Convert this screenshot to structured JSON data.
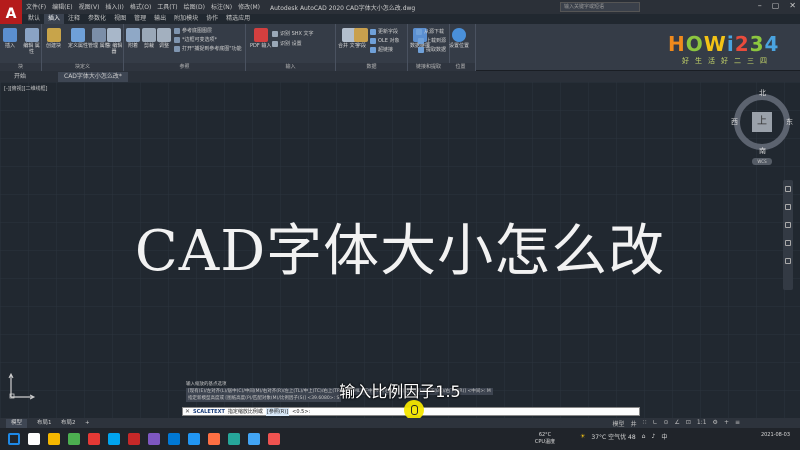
{
  "titlebar": {
    "app_letter": "A",
    "title": "Autodesk AutoCAD 2020   CAD字体大小怎么改.dwg",
    "search_placeholder": "输入关键字或短语",
    "menus": [
      "文件(F)",
      "编辑(E)",
      "视图(V)",
      "插入(I)",
      "格式(O)",
      "工具(T)",
      "绘图(D)",
      "标注(N)",
      "修改(M)"
    ]
  },
  "ribbon_tabs": [
    "默认",
    "插入",
    "注释",
    "参数化",
    "视图",
    "管理",
    "输出",
    "附加模块",
    "协作",
    "精选应用"
  ],
  "ribbon_active_tab": "插入",
  "ribbon": {
    "panels": {
      "block": "块",
      "block_def": "块定义",
      "reference": "参照",
      "import": "输入",
      "data": "数据",
      "link_extract": "链接和提取",
      "location": "位置"
    },
    "buttons": {
      "insert": "插入",
      "edit_attr": "编辑\n属性",
      "create_block": "创建块",
      "define_attr": "定义属性",
      "manage_attr": "管理\n属性",
      "block_editor": "块\n编辑器",
      "attach": "附着",
      "clip": "剪裁",
      "adjust": "调整",
      "pdf_import": "PDF\n输入",
      "merge_text": "合并\n文字",
      "field": "字段",
      "data_link": "数据链接",
      "set_location": "设置位置"
    },
    "small_items": {
      "ref_underlay": "参考底图图层",
      "frames": "*边框可变选项*",
      "snap": "打开\"捕捉到参考底图\"功能",
      "shx_text": "识别 SHX 文字",
      "settings": "识别 设置",
      "update_fields": "更新字段",
      "ole": "OLE 对象",
      "hyperlink": "超链接",
      "download_from_source": "从源下载",
      "upload_to_source": "上载到源",
      "extract_data": "提取数据"
    }
  },
  "brand": {
    "main": "HOWi234",
    "sub": "好生活好二三四",
    "colors": [
      "#f08a1c",
      "#8cc63f",
      "#f3c316",
      "#4aa3df",
      "#e94b3c",
      "#8cc63f",
      "#4aa3df"
    ]
  },
  "doc_tabs": [
    "开始",
    "CAD字体大小怎么改*"
  ],
  "view_label": "[-][俯视][二维线框]",
  "heading": "CAD字体大小怎么改",
  "viewcube": {
    "north": "北",
    "south": "南",
    "east": "东",
    "west": "西",
    "face": "上",
    "wcs": "WCS"
  },
  "command_history": [
    "输入缩放的基点选项",
    "[现有(E)/左对齐(L)/居中(C)/中间(M)/右对齐(R)/左上(TL)/中上(TC)/右上(TR)/左中(ML)/正中(MC)/右中(MR)/左下(BL)/中下(BC)/右下(BR)] <中间>: M",
    "指定新模型高度或 [图纸高度(P)/匹配对象(M)/比例因子(S)] <39.6080>: S"
  ],
  "subtitle": "输入比例因子1.5",
  "command_line": {
    "close": "✕",
    "name": "SCALETEXT",
    "prompt": "指定缩放比例或",
    "option": "[参照(R)]",
    "default": "<0.5>:"
  },
  "layout_tabs": [
    "模型",
    "布局1",
    "布局2",
    "+"
  ],
  "status_items": [
    "模型",
    "井",
    "∷",
    "∟",
    "⊙",
    "∠",
    "⊡",
    "1:1",
    "⚙",
    "+",
    "≡"
  ],
  "taskbar": {
    "cpu_temp": "62°C",
    "cpu_label": "CPU温度",
    "weather": "37°C 空气优 48",
    "ime": "中",
    "time": "",
    "date": "2021-08-03",
    "icon_colors": [
      "#1e88e5",
      "#ffffff",
      "#f5b700",
      "#4caf50",
      "#e53935",
      "#00a4ef",
      "#c62828",
      "#7e57c2",
      "#0078d4",
      "#2196f3",
      "#ff7043",
      "#26a69a",
      "#42a5f5",
      "#ef5350"
    ]
  }
}
